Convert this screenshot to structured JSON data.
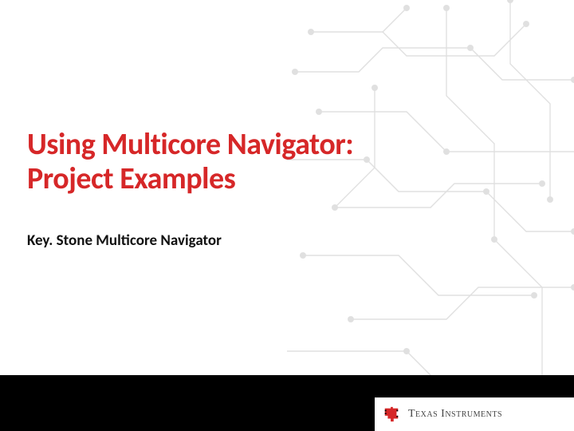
{
  "slide": {
    "title_line1": "Using Multicore Navigator:",
    "title_line2": "Project Examples",
    "subtitle": "Key. Stone Multicore Navigator"
  },
  "footer": {
    "brand_part1": "Texas ",
    "brand_part2": "Instruments"
  },
  "colors": {
    "title": "#d62728",
    "footer_bar": "#000000",
    "circuit": "#bfbfbf"
  }
}
